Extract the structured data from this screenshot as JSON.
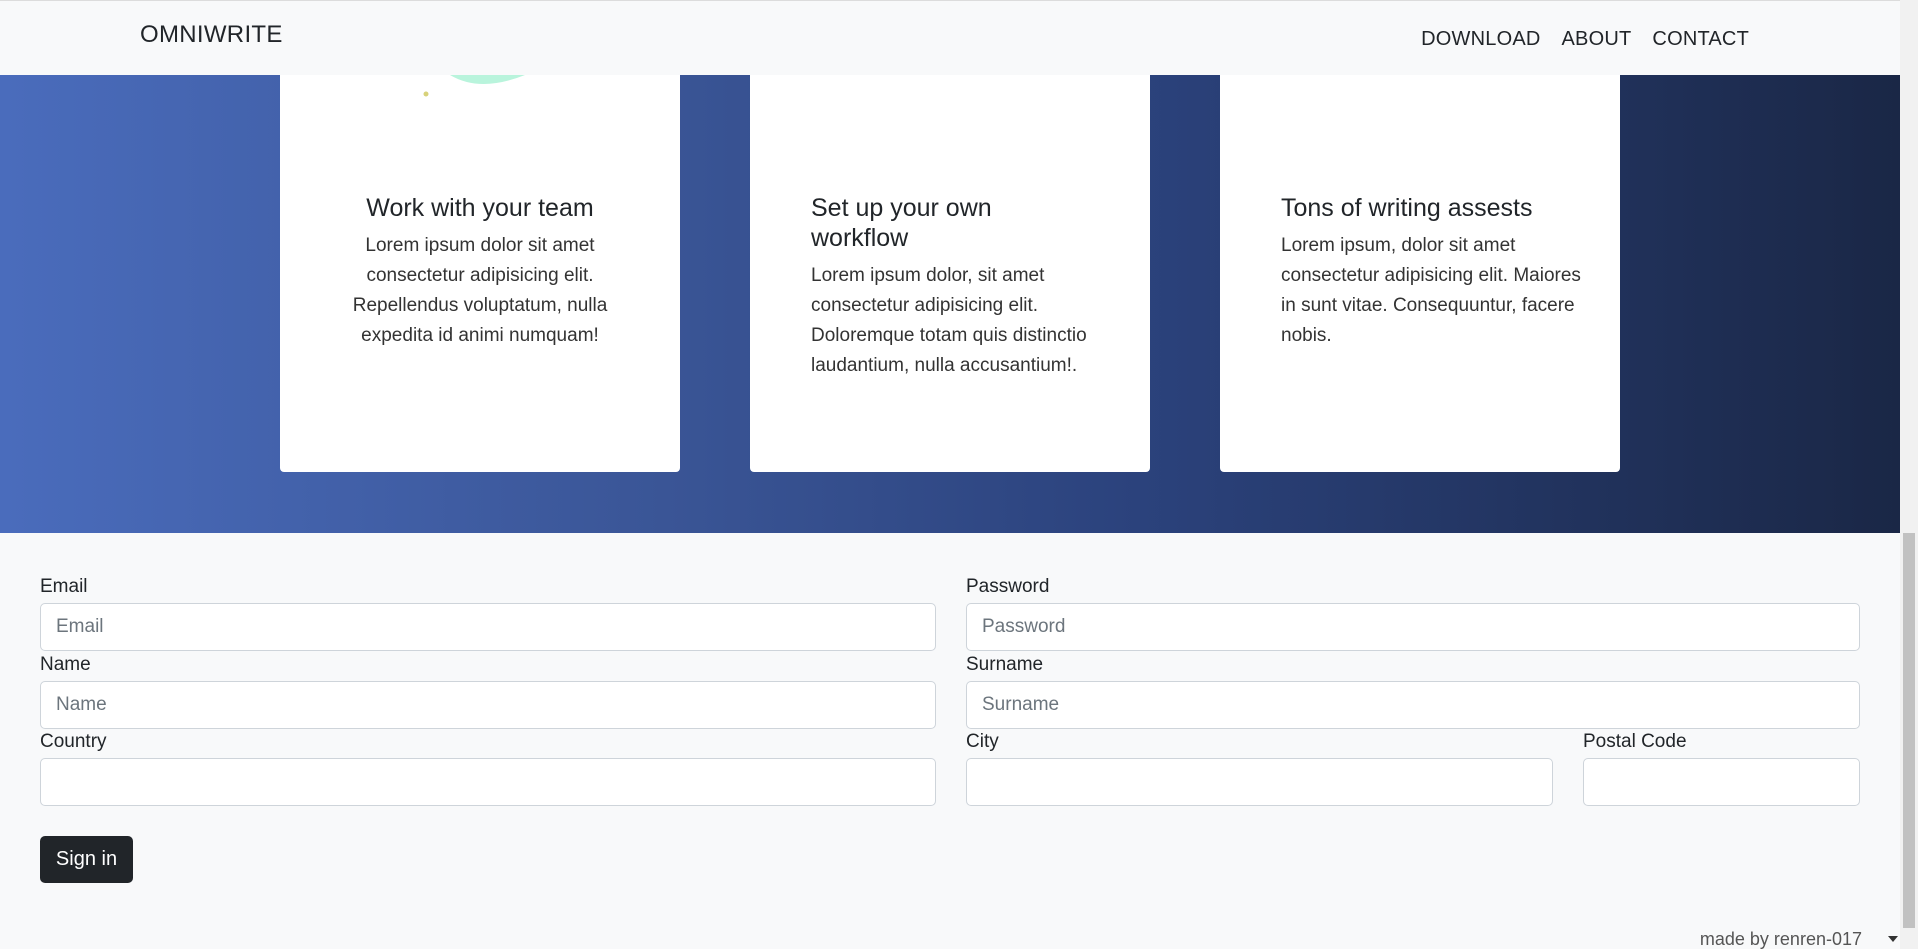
{
  "navbar": {
    "brand": "OMNIWRITE",
    "links": [
      "DOWNLOAD",
      "ABOUT",
      "CONTACT"
    ]
  },
  "cards": [
    {
      "title": "Work with your team",
      "text": "Lorem ipsum dolor sit amet consectetur adipisicing elit. Repellendus voluptatum, nulla expedita id animi numquam!"
    },
    {
      "title": "Set up your own workflow",
      "text": "Lorem ipsum dolor, sit amet consectetur adipisicing elit. Doloremque totam quis distinctio laudantium, nulla accusantium!."
    },
    {
      "title": "Tons of writing assests",
      "text": "Lorem ipsum, dolor sit amet consectetur adipisicing elit. Maiores in sunt vitae. Consequuntur, facere nobis."
    }
  ],
  "form": {
    "email": {
      "label": "Email",
      "placeholder": "Email"
    },
    "password": {
      "label": "Password",
      "placeholder": "Password"
    },
    "name": {
      "label": "Name",
      "placeholder": "Name"
    },
    "surname": {
      "label": "Surname",
      "placeholder": "Surname"
    },
    "country": {
      "label": "Country",
      "placeholder": ""
    },
    "city": {
      "label": "City",
      "placeholder": ""
    },
    "postal_code": {
      "label": "Postal Code",
      "placeholder": ""
    },
    "submit_label": "Sign in"
  },
  "footer": {
    "credit": "made by renren-017"
  },
  "colors": {
    "gradient_start": "#4a6cbc",
    "gradient_end": "#1a2746",
    "button_bg": "#212529",
    "page_bg": "#f8f9fa"
  },
  "icons": {
    "footer_caret": "caret-down-icon"
  }
}
